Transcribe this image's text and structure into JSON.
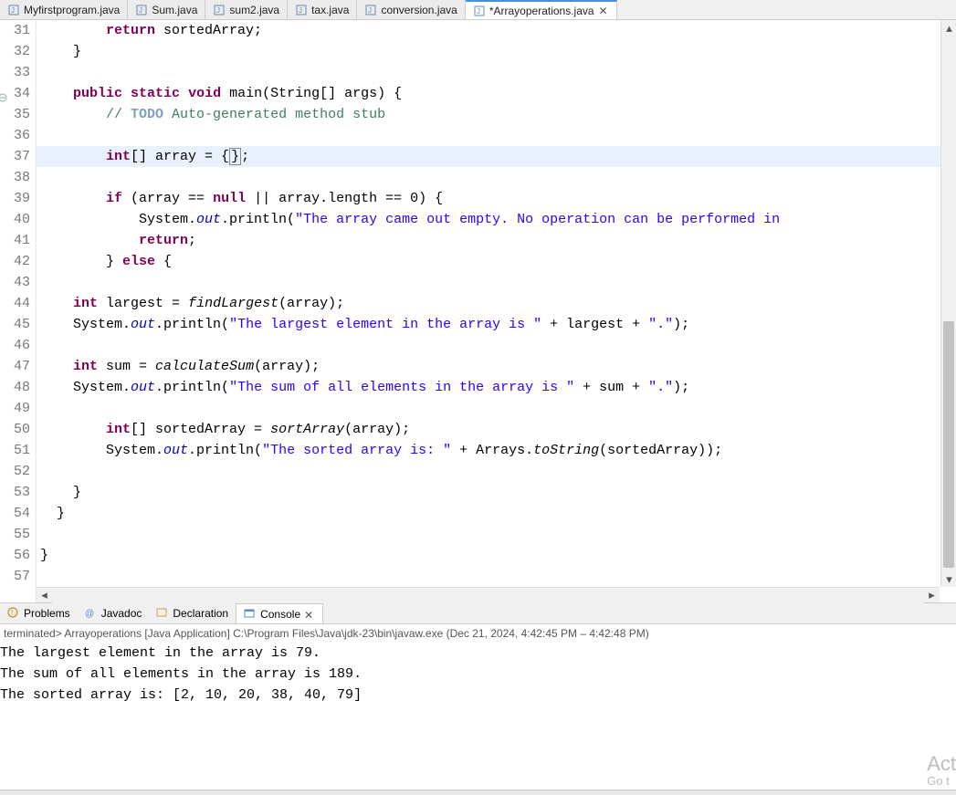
{
  "tabs": [
    {
      "label": "Myfirstprogram.java",
      "active": false
    },
    {
      "label": "Sum.java",
      "active": false
    },
    {
      "label": "sum2.java",
      "active": false
    },
    {
      "label": "tax.java",
      "active": false
    },
    {
      "label": "conversion.java",
      "active": false
    },
    {
      "label": "*Arrayoperations.java",
      "active": true
    }
  ],
  "lineStart": 31,
  "lineEnd": 57,
  "highlightLine": 37,
  "foldMarkerLine": 34,
  "code": {
    "l31": {
      "indent": "        ",
      "kw": "return",
      "rest": " sortedArray;"
    },
    "l32": {
      "text": "    }"
    },
    "l33": {
      "text": ""
    },
    "l34": {
      "indent": "    ",
      "kw1": "public",
      "kw2": "static",
      "kw3": "void",
      "name": " main(String[] args) {"
    },
    "l35": {
      "indent": "        ",
      "cm": "// ",
      "todo": "TODO",
      "cmrest": " Auto-generated method stub"
    },
    "l36": {
      "text": ""
    },
    "l37": {
      "indent": "        ",
      "kw": "int",
      "mid": "[] array = {",
      "box": "}",
      "end": ";"
    },
    "l38": {
      "text": ""
    },
    "l39": {
      "indent": "        ",
      "kw": "if",
      "a": " (array == ",
      "kw2": "null",
      "b": " || array.length == 0) {"
    },
    "l40": {
      "indent": "            System.",
      "fld": "out",
      "mid": ".println(",
      "str": "\"The array came out empty. No operation can be performed in"
    },
    "l41": {
      "indent": "            ",
      "kw": "return",
      "end": ";"
    },
    "l42": {
      "indent": "        } ",
      "kw": "else",
      "end": " {"
    },
    "l43": {
      "text": ""
    },
    "l44": {
      "indent": "    ",
      "kw": "int",
      "a": " largest = ",
      "mth": "findLargest",
      "b": "(array);"
    },
    "l45": {
      "indent": "    System.",
      "fld": "out",
      "mid": ".println(",
      "str": "\"The largest element in the array is \"",
      "a": " + largest + ",
      "str2": "\".\"",
      "end": ");"
    },
    "l46": {
      "text": ""
    },
    "l47": {
      "indent": "    ",
      "kw": "int",
      "a": " sum = ",
      "mth": "calculateSum",
      "b": "(array);"
    },
    "l48": {
      "indent": "    System.",
      "fld": "out",
      "mid": ".println(",
      "str": "\"The sum of all elements in the array is \"",
      "a": " + sum + ",
      "str2": "\".\"",
      "end": ");"
    },
    "l49": {
      "text": ""
    },
    "l50": {
      "indent": "        ",
      "kw": "int",
      "a": "[] sortedArray = ",
      "mth": "sortArray",
      "b": "(array);"
    },
    "l51": {
      "indent": "        System.",
      "fld": "out",
      "mid": ".println(",
      "str": "\"The sorted array is: \"",
      "a": " + Arrays.",
      "mth": "toString",
      "b": "(sortedArray));"
    },
    "l52": {
      "text": ""
    },
    "l53": {
      "text": "    }"
    },
    "l54": {
      "text": "  }"
    },
    "l55": {
      "text": ""
    },
    "l56": {
      "text": "}"
    },
    "l57": {
      "text": ""
    }
  },
  "panelTabs": [
    {
      "label": "Problems",
      "active": false
    },
    {
      "label": "Javadoc",
      "active": false
    },
    {
      "label": "Declaration",
      "active": false
    },
    {
      "label": "Console",
      "active": true
    }
  ],
  "consoleHeader": "terminated> Arrayoperations [Java Application] C:\\Program Files\\Java\\jdk-23\\bin\\javaw.exe  (Dec 21, 2024, 4:42:45 PM – 4:42:48 PM)",
  "consoleOutput": [
    "The largest element in the array is 79.",
    "The sum of all elements in the array is 189.",
    "The sorted array is: [2, 10, 20, 38, 40, 79]"
  ],
  "watermark": {
    "line1": "Act",
    "line2": "Go t"
  }
}
